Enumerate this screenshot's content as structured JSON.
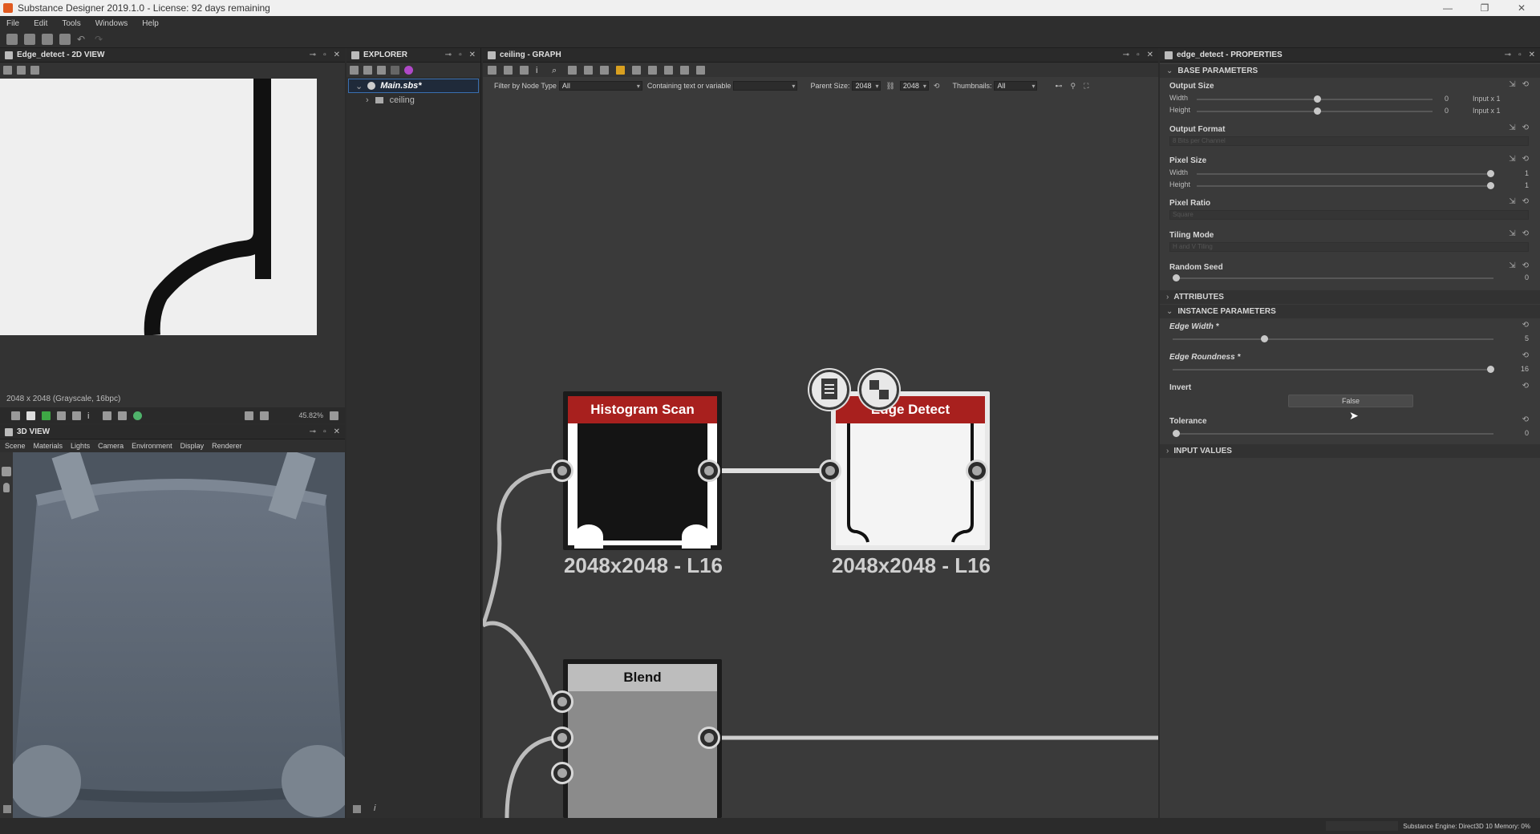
{
  "window": {
    "title": "Substance Designer 2019.1.0 - License: 92 days remaining"
  },
  "menu": [
    "File",
    "Edit",
    "Tools",
    "Windows",
    "Help"
  ],
  "view2d": {
    "title": "Edge_detect - 2D VIEW",
    "info": "2048 x 2048 (Grayscale, 16bpc)",
    "zoom": "45.82%"
  },
  "view3d": {
    "title": "3D VIEW",
    "menu": [
      "Scene",
      "Materials",
      "Lights",
      "Camera",
      "Environment",
      "Display",
      "Renderer"
    ]
  },
  "explorer": {
    "title": "EXPLORER",
    "items": [
      {
        "label": "Main.sbs*"
      },
      {
        "label": "ceiling"
      }
    ]
  },
  "graph": {
    "title": "ceiling - GRAPH",
    "filter_label": "Filter by Node Type",
    "filter_value": "All",
    "containing_label": "Containing text or variable",
    "containing_value": "",
    "parent_size_label": "Parent Size:",
    "parent_size_w": "2048",
    "parent_size_h": "2048",
    "thumbnails_label": "Thumbnails:",
    "thumbnails_value": "All",
    "nodes": [
      {
        "title": "Histogram Scan",
        "size_label": "2048x2048 - L16"
      },
      {
        "title": "Edge Detect",
        "size_label": "2048x2048 - L16"
      },
      {
        "title": "Blend"
      }
    ]
  },
  "properties": {
    "title": "edge_detect - PROPERTIES",
    "base_parameters": "BASE PARAMETERS",
    "output_size": "Output Size",
    "width": "Width",
    "height": "Height",
    "output_size_width_value": "0",
    "output_size_height_value": "0",
    "output_size_width_rel": "Input x 1",
    "output_size_height_rel": "Input x 1",
    "output_format": "Output Format",
    "output_format_value": "8 Bits per Channel",
    "pixel_size": "Pixel Size",
    "pixel_size_width_value": "1",
    "pixel_size_height_value": "1",
    "pixel_ratio": "Pixel Ratio",
    "pixel_ratio_value": "Square",
    "tiling_mode": "Tiling Mode",
    "tiling_mode_value": "H and V Tiling",
    "random_seed": "Random Seed",
    "random_seed_value": "0",
    "attributes": "ATTRIBUTES",
    "instance_parameters": "INSTANCE PARAMETERS",
    "edge_width": "Edge Width *",
    "edge_width_value": "5",
    "edge_width_level": 0.28,
    "edge_roundness": "Edge Roundness *",
    "edge_roundness_value": "16",
    "edge_roundness_level": 1.0,
    "invert": "Invert",
    "invert_value": "False",
    "tolerance": "Tolerance",
    "tolerance_value": "0",
    "input_values": "INPUT VALUES"
  },
  "status": {
    "engine": "Substance Engine: Direct3D 10  Memory: 0%"
  },
  "colors": {
    "node_red": "#a8201e",
    "accent": "#e05a20"
  }
}
